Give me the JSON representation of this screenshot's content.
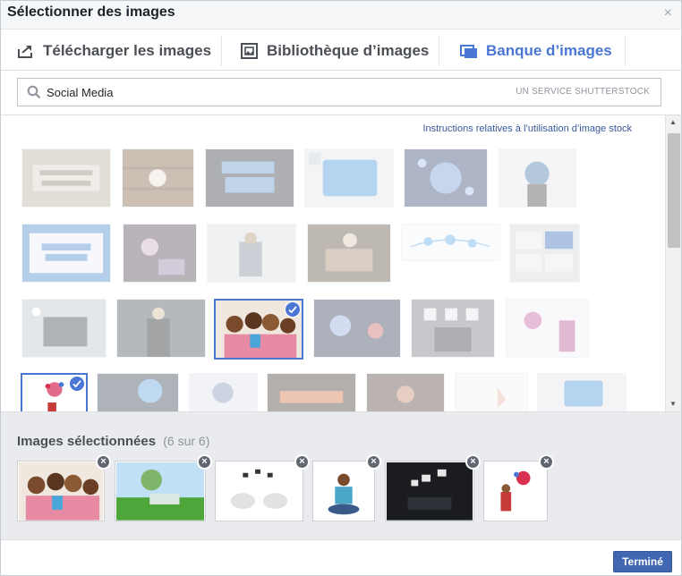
{
  "window": {
    "title": "Sélectionner des images",
    "close_symbol": "×"
  },
  "tabs": [
    {
      "label": "Télécharger les images",
      "icon": "upload-icon",
      "active": false
    },
    {
      "label": "Bibliothèque d’images",
      "icon": "image-library-icon",
      "active": false
    },
    {
      "label": "Banque d’images",
      "icon": "stock-images-icon",
      "active": true
    }
  ],
  "search": {
    "value": "Social Media",
    "provider": "UN SERVICE SHUTTERSTOCK"
  },
  "results": {
    "instructions_link": "Instructions relatives à l’utilisation d’image stock"
  },
  "selected": {
    "label": "Images sélectionnées",
    "count": "(6 sur 6)",
    "remove_symbol": "×"
  },
  "footer": {
    "done_label": "Terminé"
  },
  "colors": {
    "accent": "#4a77d4",
    "button": "#4267b2",
    "panel_bg": "#e9ebee"
  }
}
